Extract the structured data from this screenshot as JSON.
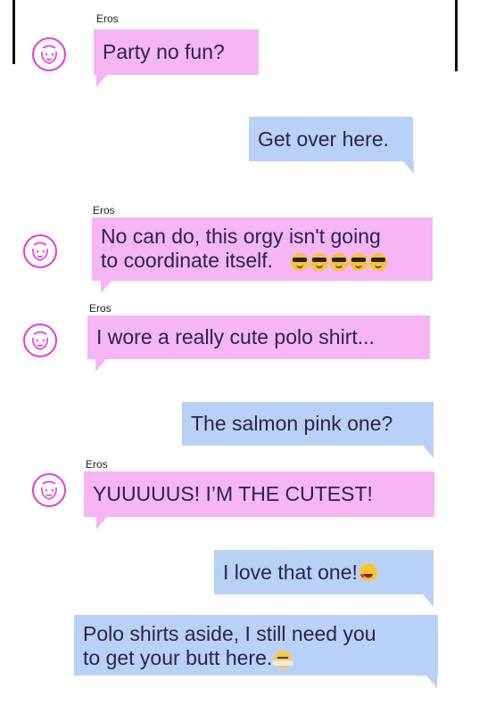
{
  "icons": {
    "avatar": "face-doodle-icon",
    "cool": "sunglasses-emoji-icon",
    "love": "heart-eyes-emoji-icon",
    "steam": "steam-from-nose-emoji-icon"
  },
  "colors": {
    "incoming_bubble": "#f6b5f3",
    "outgoing_bubble": "#bad1f7",
    "avatar_stroke": "#e23be0",
    "text": "#2b2350"
  },
  "messages": [
    {
      "sender": "Eros",
      "text": "Party no fun?"
    },
    {
      "text": "Get over here."
    },
    {
      "sender": "Eros",
      "line1": "No can do, this orgy isn't going",
      "line2": "to coordinate itself."
    },
    {
      "sender": "Eros",
      "text": "I wore a really cute polo shirt..."
    },
    {
      "text": "The salmon pink one?"
    },
    {
      "sender": "Eros",
      "text": "YUUUUUS! I’M THE CUTEST!"
    },
    {
      "text": "I love that one!"
    },
    {
      "line1": "Polo shirts aside, I still need you",
      "line2": "to get your butt here."
    }
  ]
}
